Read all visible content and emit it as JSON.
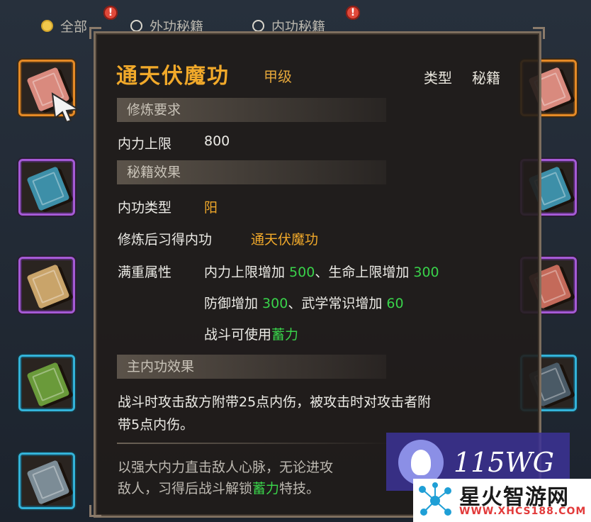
{
  "filters": [
    {
      "label": "全部",
      "selected": true,
      "alert": "!"
    },
    {
      "label": "外功秘籍",
      "selected": false,
      "alert": ""
    },
    {
      "label": "内功秘籍",
      "selected": false,
      "alert": "!"
    }
  ],
  "tooltip": {
    "name": "通天伏魔功",
    "rank": "甲级",
    "type_label": "类型",
    "type_value": "秘籍",
    "sections": {
      "requirements": "修炼要求",
      "effects": "秘籍效果",
      "main_effect": "主内功效果"
    },
    "req": {
      "label": "内力上限",
      "value": "800"
    },
    "inner_type": {
      "label": "内功类型",
      "value": "阳"
    },
    "learn": {
      "label": "修炼后习得内功",
      "value": "通天伏魔功"
    },
    "full_attrs": {
      "label": "满重属性",
      "line1_a": "内力上限增加 ",
      "line1_b": "500",
      "line1_c": "、生命上限增加 ",
      "line1_d": "300",
      "line2_a": "防御增加 ",
      "line2_b": "300",
      "line2_c": "、武学常识增加 ",
      "line2_d": "60",
      "line3_a": "战斗可使用",
      "line3_b": "蓄力"
    },
    "main_effect_line1": "战斗时攻击敌方附带25点内伤，被攻击时对攻击者附",
    "main_effect_line2": "带5点内伤。",
    "desc_line1": "以强大内力直击敌人心脉，无论进攻",
    "desc_line2_a": "敌人，习得后战斗解锁",
    "desc_line2_b": "蓄力",
    "desc_line2_c": "特技。"
  },
  "watermark": {
    "brand": "115WG",
    "site_name": "星火智游网",
    "url": "WWW.XHCS188.COM"
  },
  "colors": {
    "accent_gold": "#f1a92a",
    "value_green": "#39d24a",
    "rarity_orange": "#e58a26",
    "rarity_purple": "#a55ad6",
    "rarity_cyan": "#33b3d9"
  }
}
